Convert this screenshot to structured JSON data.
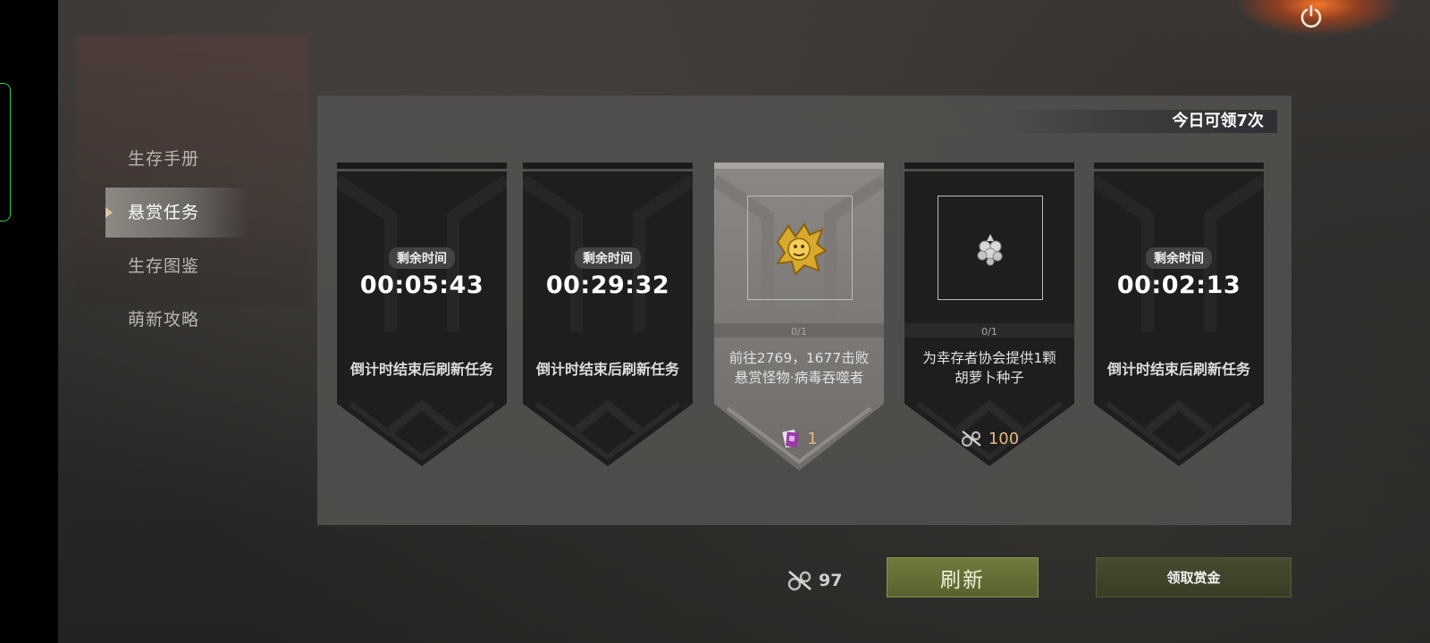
{
  "sidebar": {
    "items": [
      {
        "label": "生存手册"
      },
      {
        "label": "悬赏任务"
      },
      {
        "label": "生存图鉴"
      },
      {
        "label": "萌新攻略"
      }
    ]
  },
  "panel": {
    "daily_limit": "今日可领7次",
    "cards": [
      {
        "state": "countdown",
        "time_label": "剩余时间",
        "time": "00:05:43",
        "note": "倒计时结束后刷新任务"
      },
      {
        "state": "countdown",
        "time_label": "剩余时间",
        "time": "00:29:32",
        "note": "倒计时结束后刷新任务"
      },
      {
        "state": "task",
        "icon": "gold-beast-badge-icon",
        "progress": "0/1",
        "desc_line1": "前往2769，1677击败",
        "desc_line2": "悬赏怪物·病毒吞噬者",
        "reward_icon": "purple-card-icon",
        "reward": "1"
      },
      {
        "state": "task",
        "icon": "berry-seed-icon",
        "progress": "0/1",
        "desc_line1": "为幸存者协会提供1颗",
        "desc_line2": "胡萝卜种子",
        "reward_icon": "gear-parts-icon",
        "reward": "100"
      },
      {
        "state": "countdown",
        "time_label": "剩余时间",
        "time": "00:02:13",
        "note": "倒计时结束后刷新任务"
      }
    ]
  },
  "bottom": {
    "currency_icon": "gear-parts-icon",
    "currency_value": "97",
    "refresh_label": "刷新",
    "claim_label": "领取赏金"
  },
  "colors": {
    "accent_green": "#6f7a3d",
    "reward_text": "#e9b87f",
    "power_glow": "#ff7828"
  }
}
